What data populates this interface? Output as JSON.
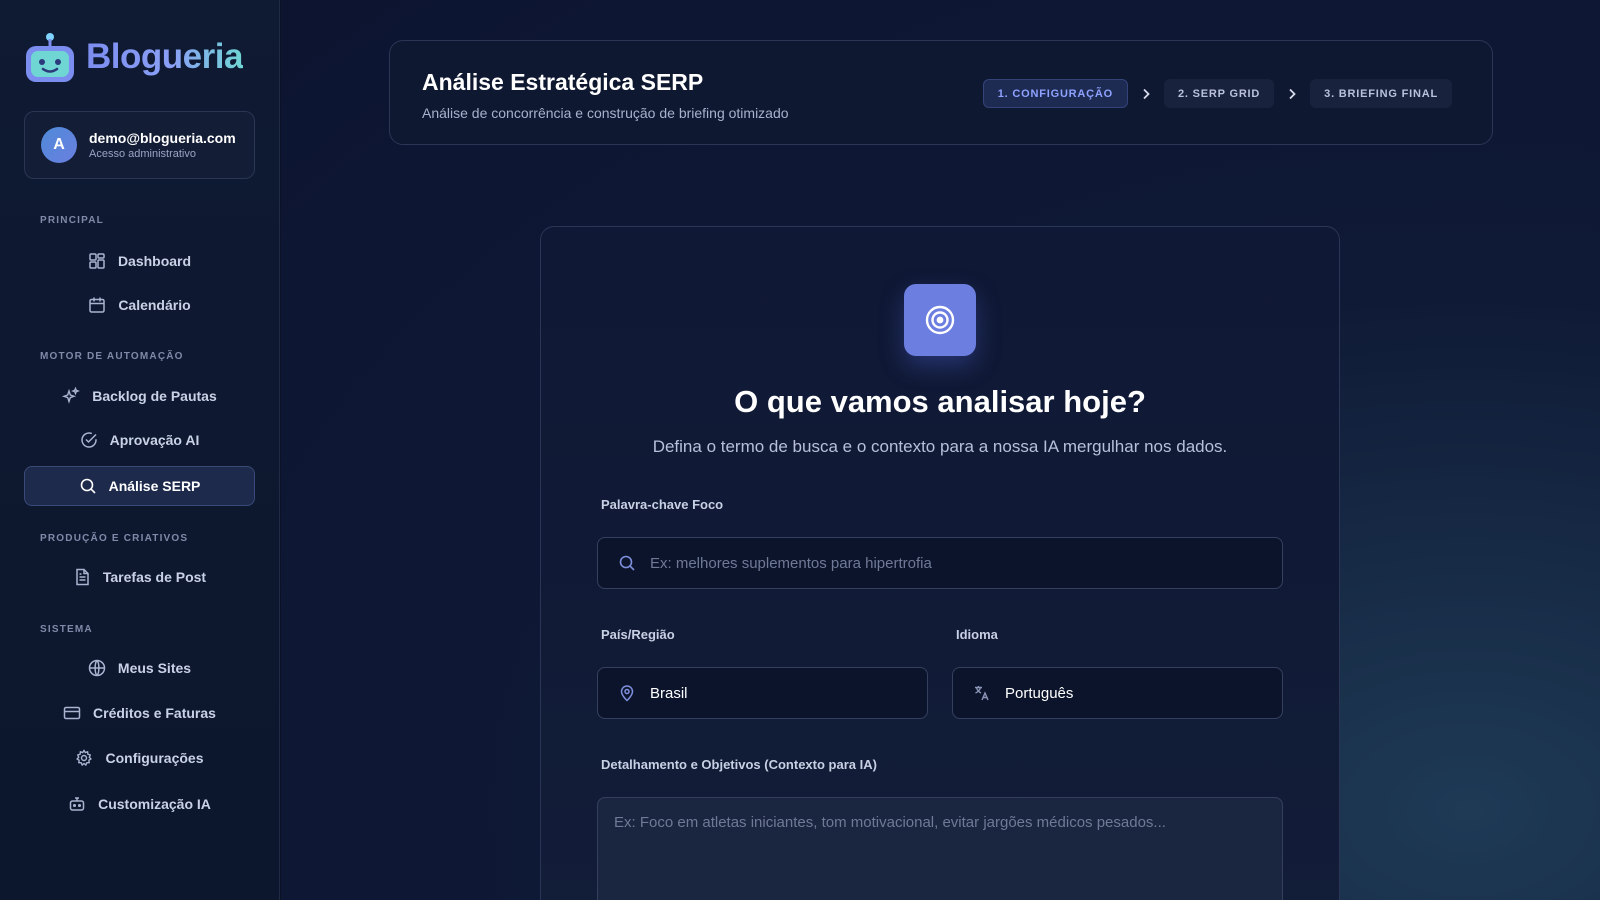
{
  "brand": {
    "name": "Blogueria"
  },
  "user": {
    "initial": "A",
    "email": "demo@blogueria.com",
    "role": "Acesso administrativo"
  },
  "sidebar": {
    "sections": [
      {
        "title": "PRINCIPAL",
        "items": [
          {
            "label": "Dashboard",
            "icon": "dashboard-grid-icon"
          },
          {
            "label": "Calendário",
            "icon": "calendar-icon"
          }
        ]
      },
      {
        "title": "MOTOR DE AUTOMAÇÃO",
        "items": [
          {
            "label": "Backlog de Pautas",
            "icon": "sparkles-icon"
          },
          {
            "label": "Aprovação AI",
            "icon": "check-circle-icon"
          },
          {
            "label": "Análise SERP",
            "icon": "search-icon",
            "active": true
          }
        ]
      },
      {
        "title": "PRODUÇÃO E CRIATIVOS",
        "items": [
          {
            "label": "Tarefas de Post",
            "icon": "document-icon"
          }
        ]
      },
      {
        "title": "SISTEMA",
        "items": [
          {
            "label": "Meus Sites",
            "icon": "globe-icon"
          },
          {
            "label": "Créditos e Faturas",
            "icon": "credit-card-icon"
          },
          {
            "label": "Configurações",
            "icon": "gear-icon"
          },
          {
            "label": "Customização IA",
            "icon": "bot-icon"
          }
        ]
      }
    ]
  },
  "header": {
    "title": "Análise Estratégica SERP",
    "subtitle": "Análise de concorrência e construção de briefing otimizado",
    "steps": [
      "1. CONFIGURAÇÃO",
      "2. SERP GRID",
      "3. BRIEFING FINAL"
    ],
    "active_step": 0
  },
  "form": {
    "title": "O que vamos analisar hoje?",
    "subtitle": "Defina o termo de busca e o contexto para a nossa IA mergulhar nos dados.",
    "keyword": {
      "label": "Palavra-chave Foco",
      "placeholder": "Ex: melhores suplementos para hipertrofia",
      "value": ""
    },
    "country": {
      "label": "País/Região",
      "value": "Brasil"
    },
    "language": {
      "label": "Idioma",
      "value": "Português"
    },
    "context": {
      "label": "Detalhamento e Objetivos (Contexto para IA)",
      "placeholder": "Ex: Foco em atletas iniciantes, tom motivacional, evitar jargões médicos pesados...",
      "value": ""
    }
  },
  "colors": {
    "accent": "#6c7ee0",
    "active_step_text": "#8ea2ff",
    "background": "#0c1430"
  }
}
